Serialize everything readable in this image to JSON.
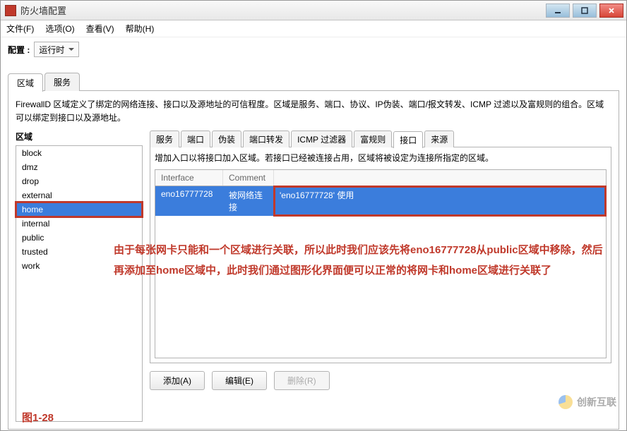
{
  "window": {
    "title": "防火墙配置"
  },
  "menu": {
    "file": "文件(F)",
    "options": "选项(O)",
    "view": "查看(V)",
    "help": "帮助(H)"
  },
  "config": {
    "label": "配置 :",
    "value": "运行时"
  },
  "top_tabs": {
    "zones": "区域",
    "services": "服务"
  },
  "desc": "FirewallD 区域定义了绑定的网络连接、接口以及源地址的可信程度。区域是服务、端口、协议、IP伪装、端口/报文转发、ICMP 过滤以及富规则的组合。区域可以绑定到接口以及源地址。",
  "zone_section": {
    "title": "区域",
    "items": [
      "block",
      "dmz",
      "drop",
      "external",
      "home",
      "internal",
      "public",
      "trusted",
      "work"
    ],
    "selected_index": 4,
    "boxed_index": 4
  },
  "inner_tabs": {
    "items": [
      "服务",
      "端口",
      "伪装",
      "端口转发",
      "ICMP 过滤器",
      "富规则",
      "接口",
      "来源"
    ],
    "active_index": 6
  },
  "interface_panel": {
    "hint": "增加入口以将接口加入区域。若接口已经被连接占用，区域将被设定为连接所指定的区域。",
    "cols": {
      "c1": "Interface",
      "c2": "Comment",
      "c3": ""
    },
    "row": {
      "iface": "eno16777728",
      "comment": "被网络连接",
      "usage": "'eno16777728' 使用"
    },
    "buttons": {
      "add": "添加(A)",
      "edit": "编辑(E)",
      "remove": "删除(R)"
    }
  },
  "overlay": "由于每张网卡只能和一个区域进行关联，所以此时我们应该先将eno16777728从public区域中移除，然后再添加至home区域中，此时我们通过图形化界面便可以正常的将网卡和home区域进行关联了",
  "figure_label": "图1-28",
  "watermark": "创新互联"
}
